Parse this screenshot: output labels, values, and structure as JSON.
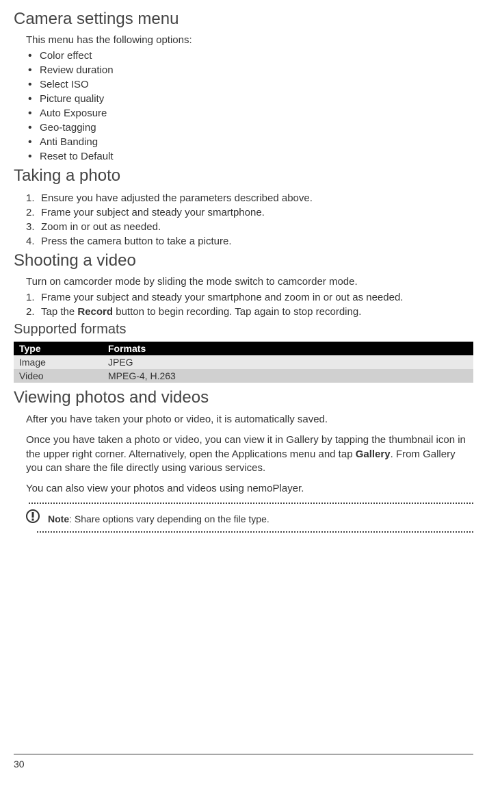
{
  "section1": {
    "heading": "Camera settings menu",
    "intro": "This menu has the following options:",
    "bullets": [
      "Color effect",
      "Review duration",
      "Select ISO",
      "Picture quality",
      "Auto Exposure",
      "Geo-tagging",
      "Anti Banding",
      "Reset to Default"
    ]
  },
  "section2": {
    "heading": "Taking a photo",
    "steps": [
      "Ensure you have adjusted the parameters described above.",
      "Frame your subject and steady your smartphone.",
      "Zoom in or out as needed.",
      " Press the camera button to take a picture."
    ]
  },
  "section3": {
    "heading": "Shooting a video",
    "intro": "Turn on camcorder mode by sliding the mode switch to camcorder mode.",
    "step1": "Frame your subject and steady your smartphone and zoom in or out as needed.",
    "step2_pre": "Tap the ",
    "step2_bold": "Record",
    "step2_post": " button to begin recording. Tap again to stop recording."
  },
  "section4": {
    "heading": "Supported formats",
    "table": {
      "headers": [
        "Type",
        "Formats"
      ],
      "rows": [
        [
          "Image",
          "JPEG"
        ],
        [
          "Video",
          "MPEG-4, H.263"
        ]
      ]
    }
  },
  "section5": {
    "heading": "Viewing photos and videos",
    "para1": "After you have taken your photo or video, it is automatically saved.",
    "para2_pre": "Once you have taken a photo or video, you can view it in Gallery by tapping the thumbnail icon in the upper right corner. Alternatively, open the Applications menu and tap ",
    "para2_bold": "Gallery",
    "para2_post": ". From Gallery you can share the file directly using various services.",
    "para3": "You can also view your photos and videos using nemoPlayer.",
    "note_label": "Note",
    "note_text": ": Share options vary depending on the file type."
  },
  "page_number": "30"
}
